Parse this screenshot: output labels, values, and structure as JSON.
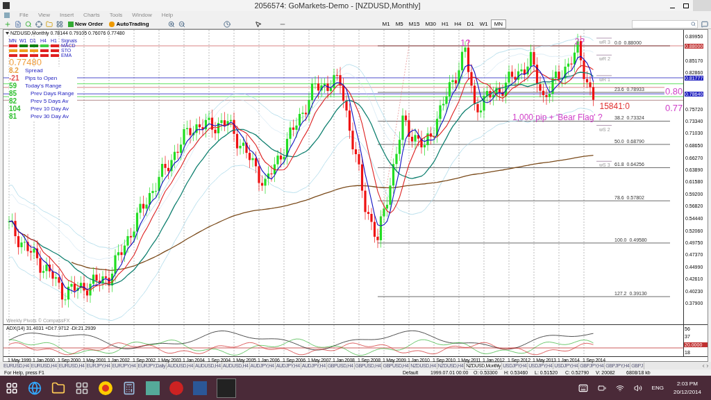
{
  "window": {
    "title": "2056574: GoMarkets-Demo - [NZDUSD,Monthly]"
  },
  "menu": [
    "File",
    "View",
    "Insert",
    "Charts",
    "Tools",
    "Window",
    "Help"
  ],
  "toolbar": {
    "buttons": [
      "New Order",
      "AutoTrading"
    ],
    "timeframes": [
      {
        "label": "M1",
        "selected": false
      },
      {
        "label": "M5",
        "selected": false
      },
      {
        "label": "M15",
        "selected": false
      },
      {
        "label": "M30",
        "selected": false
      },
      {
        "label": "H1",
        "selected": false
      },
      {
        "label": "H4",
        "selected": false
      },
      {
        "label": "D1",
        "selected": false
      },
      {
        "label": "W1",
        "selected": false
      },
      {
        "label": "MN",
        "selected": true
      }
    ]
  },
  "chart": {
    "header": "NZDUSD,Monthly  0.78144 0.79105 0.76076 0.77480",
    "signals": {
      "columns": [
        "MN",
        "W1",
        "D1",
        "H4",
        "H1"
      ],
      "title": "Signals",
      "rows": [
        {
          "label": "MACD",
          "cells": [
            {
              "color": "#e02020"
            },
            {
              "color": "#108010"
            },
            {
              "color": "#108010"
            },
            {
              "color": "#40d040"
            },
            {
              "color": "#e02020"
            }
          ]
        },
        {
          "label": "STO",
          "cells": [
            {
              "color": "#f0a020"
            },
            {
              "color": "#f0a020"
            },
            {
              "color": "#f0a020"
            },
            {
              "color": "#e02020"
            },
            {
              "color": "#e02020"
            }
          ]
        },
        {
          "label": "EMA",
          "cells": [
            {
              "color": "#e02020"
            },
            {
              "color": "#e02020"
            },
            {
              "color": "#e02020"
            },
            {
              "color": "#e02020"
            },
            {
              "color": "#e02020"
            }
          ]
        }
      ]
    },
    "price": "0.77480",
    "stats": [
      {
        "value": "8.2",
        "label": "Spread",
        "color": "#e8a040"
      },
      {
        "value": "-21",
        "label": "Pips to Open",
        "color": "#e05050"
      },
      {
        "value": "59",
        "label": "Today's Range",
        "color": "#30c030"
      },
      {
        "value": "85",
        "label": "Prev Days Range",
        "color": "#30c030"
      },
      {
        "value": "82",
        "label": "Prev 5 Days Av",
        "color": "#30c030"
      },
      {
        "value": "104",
        "label": "Prev 10 Day Av",
        "color": "#30c030"
      },
      {
        "value": "81",
        "label": "Prev 30 Day Av",
        "color": "#30c030"
      }
    ],
    "annotations": [
      {
        "text": "1?",
        "kind": "peak"
      },
      {
        "text": "2?",
        "kind": "peak"
      },
      {
        "text": "15841:0",
        "kind": "counter"
      },
      {
        "text": "1,000 pip + 'Bear Flag' ?",
        "kind": "note"
      },
      {
        "text": "0.80",
        "kind": "level"
      },
      {
        "text": "0.77",
        "kind": "level"
      }
    ],
    "fib_levels": [
      "0.0  0.88000",
      "23.6  0.78933",
      "38.2  0.73324",
      "50.0  0.68790",
      "61.8  0.64256",
      "78.6  0.57802",
      "100.0  0.49580",
      "127.2  0.39130"
    ],
    "pivots": [
      "wR 3",
      "wR 2",
      "wR 1",
      "wS 2",
      "wS 3"
    ],
    "pivot_credit": "Weekly Pivots © CompassFX",
    "price_axis": [
      "0.89950",
      "0.88000",
      "0.85170",
      "0.82860",
      "0.81777",
      "0.78640",
      "0.75720",
      "0.73340",
      "0.71030",
      "0.68650",
      "0.66270",
      "0.63890",
      "0.61580",
      "0.59200",
      "0.56820",
      "0.54440",
      "0.52060",
      "0.49750",
      "0.47370",
      "0.44990",
      "0.42610",
      "0.40230",
      "0.37900"
    ],
    "adx": {
      "header": "ADX(14) 31.4031 +DI:7.9712 -DI:21.2939",
      "axis": [
        "56",
        "37",
        "20.0000",
        "18"
      ]
    },
    "time_axis": [
      "1 May 1999",
      "1 Jan 2000",
      "1 Sep 2000",
      "1 May 2001",
      "1 Jan 2002",
      "1 Sep 2002",
      "1 May 2003",
      "1 Jan 2004",
      "1 Sep 2004",
      "1 May 2005",
      "1 Jan 2006",
      "1 Sep 2006",
      "1 May 2007",
      "1 Jan 2008",
      "1 Sep 2008",
      "1 May 2009",
      "1 Jan 2010",
      "1 Sep 2010",
      "1 May 2011",
      "1 Jan 2012",
      "1 Sep 2012",
      "1 May 2013",
      "1 Jan 2014",
      "1 Sep 2014"
    ]
  },
  "chart_tabs": [
    {
      "label": "EURUSD,H4",
      "selected": false
    },
    {
      "label": "EURUSD,H4",
      "selected": false
    },
    {
      "label": "EURUSD,H4",
      "selected": false
    },
    {
      "label": "EURJPY,H4",
      "selected": false
    },
    {
      "label": "EURJPY,H4",
      "selected": false
    },
    {
      "label": "EURJPY,Daily",
      "selected": false
    },
    {
      "label": "AUDUSD,H4",
      "selected": false
    },
    {
      "label": "AUDUSD,H4",
      "selected": false
    },
    {
      "label": "AUDUSD,H4",
      "selected": false
    },
    {
      "label": "AUDJPY,H4",
      "selected": false
    },
    {
      "label": "AUDJPY,H4",
      "selected": false
    },
    {
      "label": "AUDJPY,H4",
      "selected": false
    },
    {
      "label": "GBPUSD,H4",
      "selected": false
    },
    {
      "label": "GBPUSD,H4",
      "selected": false
    },
    {
      "label": "GBPUSD,H4",
      "selected": false
    },
    {
      "label": "NZDUSD,H4",
      "selected": false
    },
    {
      "label": "NZDUSD,H4",
      "selected": false
    },
    {
      "label": "NZDUSD,Monthly",
      "selected": true
    },
    {
      "label": "USDJPY,H4",
      "selected": false
    },
    {
      "label": "USDJPY,H4",
      "selected": false
    },
    {
      "label": "USDJPY,H4",
      "selected": false
    },
    {
      "label": "GBPJPY,H4",
      "selected": false
    },
    {
      "label": "GBPJPY,H4",
      "selected": false
    },
    {
      "label": "GBPJ",
      "selected": false
    }
  ],
  "status_bar": [
    "For Help, press F1",
    "Default",
    "1999.07.01 00:00",
    "O: 0.53300",
    "H: 0.53460",
    "L: 0.51520",
    "C: 0.52790",
    "V: 20082",
    "6808/18 kb"
  ],
  "taskbar": {
    "language": "ENG",
    "time": "2:03 PM",
    "date": "20/12/2014"
  }
}
